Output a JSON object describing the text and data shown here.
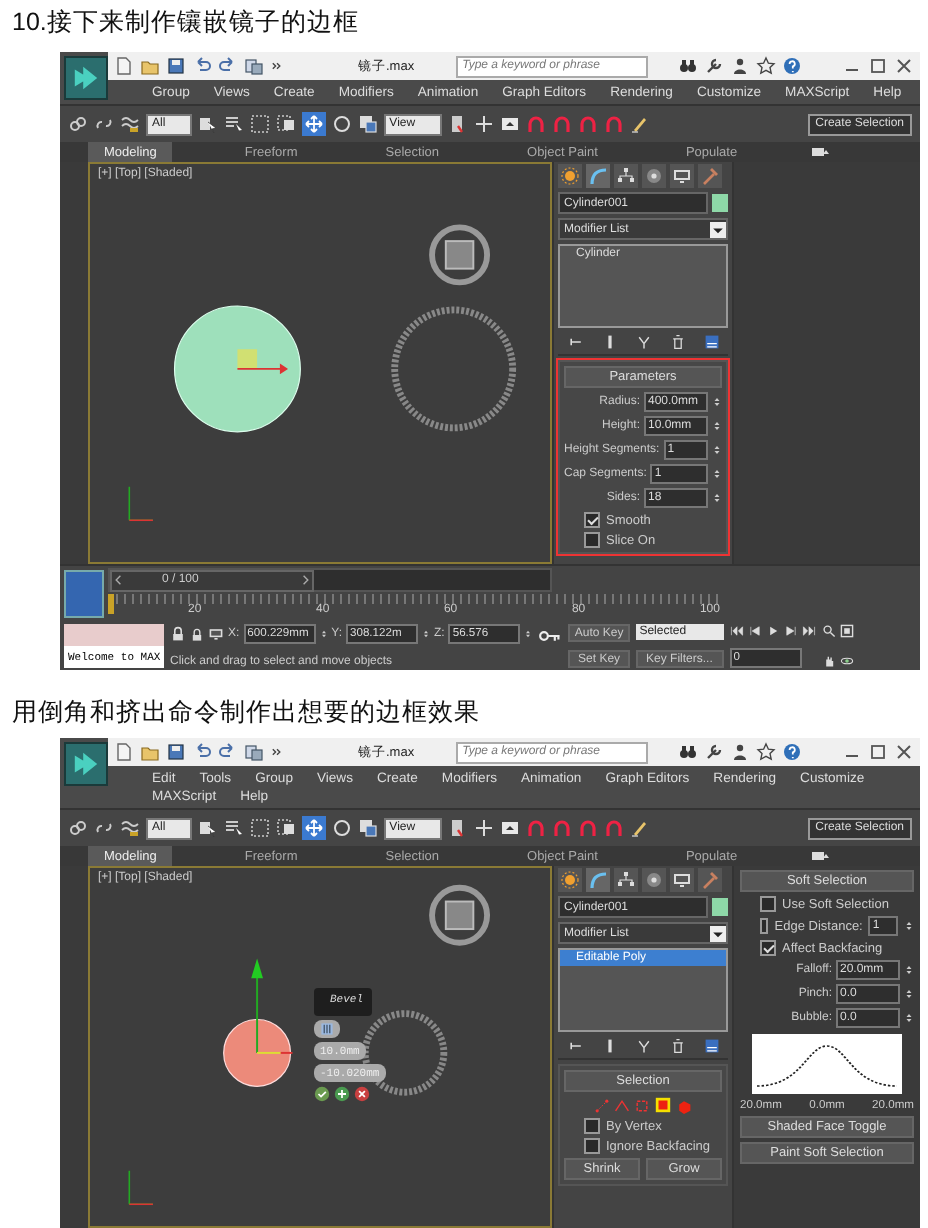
{
  "sections": [
    {
      "caption": "10.接下来制作镶嵌镜子的边框",
      "screenshot": {
        "file_name": "镜子.max",
        "search_placeholder": "Type a keyword or phrase",
        "menu": [
          "Group",
          "Views",
          "Create",
          "Modifiers",
          "Animation",
          "Graph Editors",
          "Rendering",
          "Customize",
          "MAXScript",
          "Help"
        ],
        "selection_filter": "All",
        "reference_coord": "View",
        "named_selection": "Create Selection",
        "ribbon_tabs": [
          {
            "label": "Modeling",
            "selected": true
          },
          {
            "label": "Freeform",
            "selected": false
          },
          {
            "label": "Selection",
            "selected": false
          },
          {
            "label": "Object Paint",
            "selected": false
          },
          {
            "label": "Populate",
            "selected": false
          }
        ],
        "viewport": {
          "label": "[+] [Top] [Shaded]",
          "kind": "cylinder"
        },
        "object_name": "Cylinder001",
        "modifier_list": "Modifier List",
        "stack": [
          {
            "label": "Cylinder",
            "selected": false
          }
        ],
        "rollout": {
          "kind": "parameters",
          "title": "Parameters",
          "highlighted": true,
          "fields": [
            {
              "label": "Radius:",
              "value": "400.0mm"
            },
            {
              "label": "Height:",
              "value": "10.0mm"
            },
            {
              "label": "Height Segments:",
              "value": "1"
            },
            {
              "label": "Cap Segments:",
              "value": "1"
            },
            {
              "label": "Sides:",
              "value": "18"
            }
          ],
          "checks": [
            {
              "label": "Smooth",
              "checked": true
            },
            {
              "label": "Slice On",
              "checked": false
            }
          ]
        },
        "bottom": {
          "time_slider": "0 / 100",
          "level": 0,
          "ticks": [
            "20",
            "40",
            "60",
            "80",
            "100"
          ],
          "prompt": "Welcome to MAX",
          "message": "Click and drag to select and move objects",
          "coords": [
            {
              "label": "X:",
              "value": "600.229mm"
            },
            {
              "label": "Y:",
              "value": "308.122m"
            },
            {
              "label": "Z:",
              "value": "56.576"
            }
          ],
          "auto_key": "Auto Key",
          "set_key": "Set Key",
          "key_mode": "Selected",
          "key_filters": "Key Filters...",
          "frame": "0"
        }
      }
    },
    {
      "caption": "用倒角和挤出命令制作出想要的边框效果",
      "screenshot": {
        "file_name": "镜子.max",
        "search_placeholder": "Type a keyword or phrase",
        "menu": [
          "Edit",
          "Tools",
          "Group",
          "Views",
          "Create",
          "Modifiers",
          "Animation",
          "Graph Editors",
          "Rendering",
          "Customize",
          "MAXScript",
          "Help"
        ],
        "selection_filter": "All",
        "reference_coord": "View",
        "named_selection": "Create Selection",
        "ribbon_tabs": [
          {
            "label": "Modeling",
            "selected": true
          },
          {
            "label": "Freeform",
            "selected": false
          },
          {
            "label": "Selection",
            "selected": false
          },
          {
            "label": "Object Paint",
            "selected": false
          },
          {
            "label": "Populate",
            "selected": false
          }
        ],
        "viewport": {
          "label": "[+] [Top] [Shaded]",
          "kind": "poly",
          "caddy": {
            "title": "Bevel",
            "values": [
              "10.0mm",
              "-10.020mm"
            ]
          }
        },
        "object_name": "Cylinder001",
        "modifier_list": "Modifier List",
        "stack": [
          {
            "label": "Editable Poly",
            "selected": true
          }
        ],
        "rollout": {
          "kind": "selection",
          "title": "Selection",
          "highlighted": false,
          "checks": [
            {
              "label": "By Vertex",
              "checked": false
            },
            {
              "label": "Ignore Backfacing",
              "checked": false
            }
          ],
          "buttons": [
            "Shrink",
            "Grow"
          ]
        },
        "side_panel": {
          "title": "Soft Selection",
          "checks": [
            {
              "label": "Use Soft Selection",
              "checked": false
            },
            {
              "label": "Edge Distance:",
              "checked": false,
              "value": "1"
            },
            {
              "label": "Affect Backfacing",
              "checked": true
            }
          ],
          "fields": [
            {
              "label": "Falloff:",
              "value": "20.0mm"
            },
            {
              "label": "Pinch:",
              "value": "0.0"
            },
            {
              "label": "Bubble:",
              "value": "0.0"
            }
          ],
          "curve_labels": [
            "20.0mm",
            "0.0mm",
            "20.0mm"
          ],
          "button": "Shaded Face Toggle",
          "next_rollout": "Paint Soft Selection"
        }
      }
    }
  ]
}
